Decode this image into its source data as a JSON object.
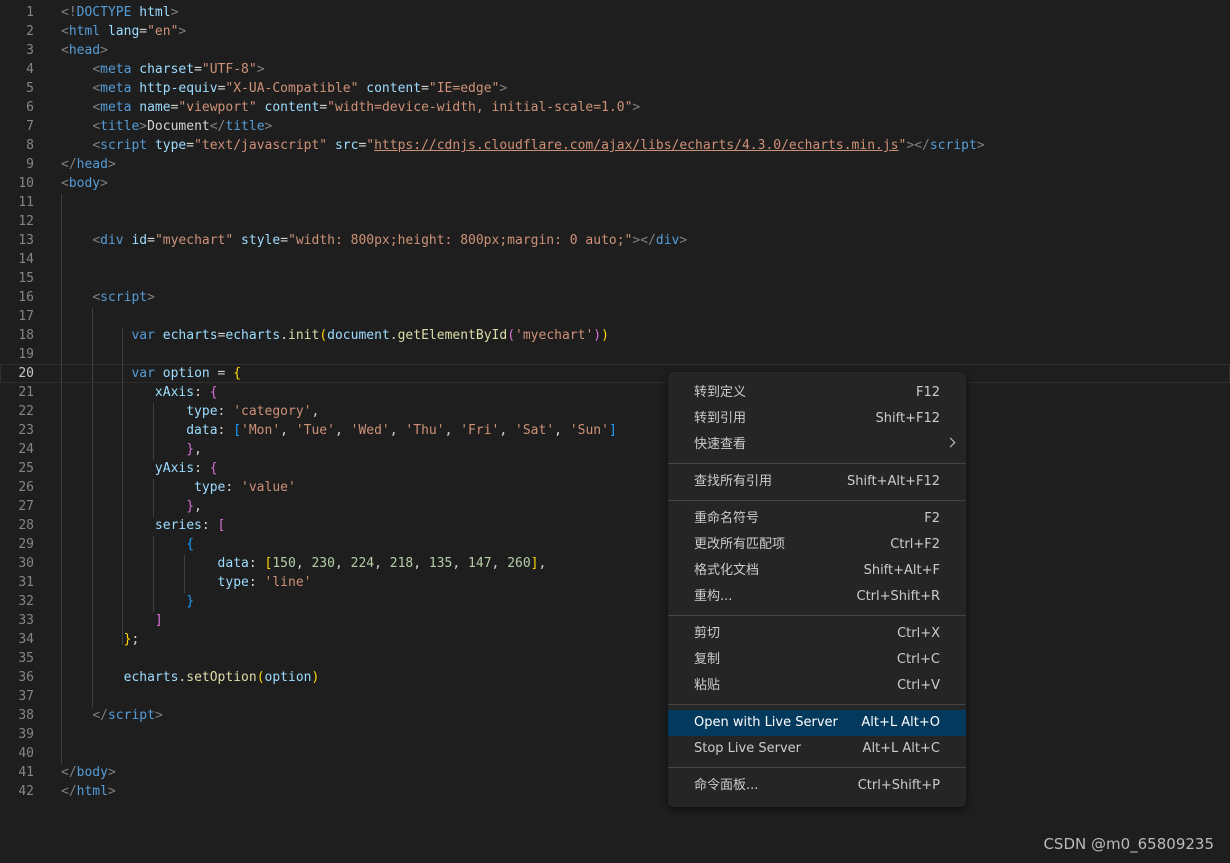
{
  "editor": {
    "current_line": "20",
    "line_numbers": [
      "1",
      "2",
      "3",
      "4",
      "5",
      "6",
      "7",
      "8",
      "9",
      "10",
      "11",
      "12",
      "13",
      "14",
      "15",
      "16",
      "17",
      "18",
      "19",
      "20",
      "21",
      "22",
      "23",
      "24",
      "25",
      "26",
      "27",
      "28",
      "29",
      "30",
      "31",
      "32",
      "33",
      "34",
      "35",
      "36",
      "37",
      "38",
      "39",
      "40",
      "41",
      "42"
    ],
    "lines": [
      [
        [
          "br",
          "<!"
        ],
        [
          "tag",
          "DOCTYPE"
        ],
        [
          "tx",
          " "
        ],
        [
          "at",
          "html"
        ],
        [
          "br",
          ">"
        ]
      ],
      [
        [
          "br",
          "<"
        ],
        [
          "tag",
          "html"
        ],
        [
          "tx",
          " "
        ],
        [
          "at",
          "lang"
        ],
        [
          "tx",
          "="
        ],
        [
          "st",
          "\"en\""
        ],
        [
          "br",
          ">"
        ]
      ],
      [
        [
          "br",
          "<"
        ],
        [
          "tag",
          "head"
        ],
        [
          "br",
          ">"
        ]
      ],
      [
        [
          "tx",
          "    "
        ],
        [
          "br",
          "<"
        ],
        [
          "tag",
          "meta"
        ],
        [
          "tx",
          " "
        ],
        [
          "at",
          "charset"
        ],
        [
          "tx",
          "="
        ],
        [
          "st",
          "\"UTF-8\""
        ],
        [
          "br",
          ">"
        ]
      ],
      [
        [
          "tx",
          "    "
        ],
        [
          "br",
          "<"
        ],
        [
          "tag",
          "meta"
        ],
        [
          "tx",
          " "
        ],
        [
          "at",
          "http-equiv"
        ],
        [
          "tx",
          "="
        ],
        [
          "st",
          "\"X-UA-Compatible\""
        ],
        [
          "tx",
          " "
        ],
        [
          "at",
          "content"
        ],
        [
          "tx",
          "="
        ],
        [
          "st",
          "\"IE=edge\""
        ],
        [
          "br",
          ">"
        ]
      ],
      [
        [
          "tx",
          "    "
        ],
        [
          "br",
          "<"
        ],
        [
          "tag",
          "meta"
        ],
        [
          "tx",
          " "
        ],
        [
          "at",
          "name"
        ],
        [
          "tx",
          "="
        ],
        [
          "st",
          "\"viewport\""
        ],
        [
          "tx",
          " "
        ],
        [
          "at",
          "content"
        ],
        [
          "tx",
          "="
        ],
        [
          "st",
          "\"width=device-width, initial-scale=1.0\""
        ],
        [
          "br",
          ">"
        ]
      ],
      [
        [
          "tx",
          "    "
        ],
        [
          "br",
          "<"
        ],
        [
          "tag",
          "title"
        ],
        [
          "br",
          ">"
        ],
        [
          "tx",
          "Document"
        ],
        [
          "br",
          "</"
        ],
        [
          "tag",
          "title"
        ],
        [
          "br",
          ">"
        ]
      ],
      [
        [
          "tx",
          "    "
        ],
        [
          "br",
          "<"
        ],
        [
          "tag",
          "script"
        ],
        [
          "tx",
          " "
        ],
        [
          "at",
          "type"
        ],
        [
          "tx",
          "="
        ],
        [
          "st",
          "\"text/javascript\""
        ],
        [
          "tx",
          " "
        ],
        [
          "at",
          "src"
        ],
        [
          "tx",
          "="
        ],
        [
          "st",
          "\""
        ],
        [
          "lk",
          "https://cdnjs.cloudflare.com/ajax/libs/echarts/4.3.0/echarts.min.js"
        ],
        [
          "st",
          "\""
        ],
        [
          "br",
          "></"
        ],
        [
          "tag",
          "script"
        ],
        [
          "br",
          ">"
        ]
      ],
      [
        [
          "br",
          "</"
        ],
        [
          "tag",
          "head"
        ],
        [
          "br",
          ">"
        ]
      ],
      [
        [
          "br",
          "<"
        ],
        [
          "tag",
          "body"
        ],
        [
          "br",
          ">"
        ]
      ],
      [],
      [],
      [
        [
          "tx",
          "    "
        ],
        [
          "br",
          "<"
        ],
        [
          "tag",
          "div"
        ],
        [
          "tx",
          " "
        ],
        [
          "at",
          "id"
        ],
        [
          "tx",
          "="
        ],
        [
          "st",
          "\"myechart\""
        ],
        [
          "tx",
          " "
        ],
        [
          "at",
          "style"
        ],
        [
          "tx",
          "="
        ],
        [
          "st",
          "\"width: 800px;height: 800px;margin: 0 auto;\""
        ],
        [
          "br",
          "></"
        ],
        [
          "tag",
          "div"
        ],
        [
          "br",
          ">"
        ]
      ],
      [],
      [],
      [
        [
          "tx",
          "    "
        ],
        [
          "br",
          "<"
        ],
        [
          "tag",
          "script"
        ],
        [
          "br",
          ">"
        ]
      ],
      [],
      [
        [
          "tx",
          "         "
        ],
        [
          "kw",
          "var"
        ],
        [
          "tx",
          " "
        ],
        [
          "vr",
          "echarts"
        ],
        [
          "tx",
          "="
        ],
        [
          "vr",
          "echarts"
        ],
        [
          "tx",
          "."
        ],
        [
          "fn",
          "init"
        ],
        [
          "p1",
          "("
        ],
        [
          "vr",
          "document"
        ],
        [
          "tx",
          "."
        ],
        [
          "fn",
          "getElementById"
        ],
        [
          "p2",
          "("
        ],
        [
          "st",
          "'myechart'"
        ],
        [
          "p2",
          ")"
        ],
        [
          "p1",
          ")"
        ]
      ],
      [],
      [
        [
          "tx",
          "         "
        ],
        [
          "kw",
          "var"
        ],
        [
          "tx",
          " "
        ],
        [
          "vr",
          "option"
        ],
        [
          "tx",
          " = "
        ],
        [
          "p1",
          "{"
        ]
      ],
      [
        [
          "tx",
          "            "
        ],
        [
          "vr",
          "xAxis"
        ],
        [
          "tx",
          ": "
        ],
        [
          "p2",
          "{"
        ]
      ],
      [
        [
          "tx",
          "                "
        ],
        [
          "vr",
          "type"
        ],
        [
          "tx",
          ": "
        ],
        [
          "st",
          "'category'"
        ],
        [
          "tx",
          ","
        ]
      ],
      [
        [
          "tx",
          "                "
        ],
        [
          "vr",
          "data"
        ],
        [
          "tx",
          ": "
        ],
        [
          "p3",
          "["
        ],
        [
          "st",
          "'Mon'"
        ],
        [
          "tx",
          ", "
        ],
        [
          "st",
          "'Tue'"
        ],
        [
          "tx",
          ", "
        ],
        [
          "st",
          "'Wed'"
        ],
        [
          "tx",
          ", "
        ],
        [
          "st",
          "'Thu'"
        ],
        [
          "tx",
          ", "
        ],
        [
          "st",
          "'Fri'"
        ],
        [
          "tx",
          ", "
        ],
        [
          "st",
          "'Sat'"
        ],
        [
          "tx",
          ", "
        ],
        [
          "st",
          "'Sun'"
        ],
        [
          "p3",
          "]"
        ]
      ],
      [
        [
          "tx",
          "                "
        ],
        [
          "p2",
          "}"
        ],
        [
          "tx",
          ","
        ]
      ],
      [
        [
          "tx",
          "            "
        ],
        [
          "vr",
          "yAxis"
        ],
        [
          "tx",
          ": "
        ],
        [
          "p2",
          "{"
        ]
      ],
      [
        [
          "tx",
          "                 "
        ],
        [
          "vr",
          "type"
        ],
        [
          "tx",
          ": "
        ],
        [
          "st",
          "'value'"
        ]
      ],
      [
        [
          "tx",
          "                "
        ],
        [
          "p2",
          "}"
        ],
        [
          "tx",
          ","
        ]
      ],
      [
        [
          "tx",
          "            "
        ],
        [
          "vr",
          "series"
        ],
        [
          "tx",
          ": "
        ],
        [
          "p2",
          "["
        ]
      ],
      [
        [
          "tx",
          "                "
        ],
        [
          "p3",
          "{"
        ]
      ],
      [
        [
          "tx",
          "                    "
        ],
        [
          "vr",
          "data"
        ],
        [
          "tx",
          ": "
        ],
        [
          "p1",
          "["
        ],
        [
          "nm",
          "150"
        ],
        [
          "tx",
          ", "
        ],
        [
          "nm",
          "230"
        ],
        [
          "tx",
          ", "
        ],
        [
          "nm",
          "224"
        ],
        [
          "tx",
          ", "
        ],
        [
          "nm",
          "218"
        ],
        [
          "tx",
          ", "
        ],
        [
          "nm",
          "135"
        ],
        [
          "tx",
          ", "
        ],
        [
          "nm",
          "147"
        ],
        [
          "tx",
          ", "
        ],
        [
          "nm",
          "260"
        ],
        [
          "p1",
          "]"
        ],
        [
          "tx",
          ","
        ]
      ],
      [
        [
          "tx",
          "                    "
        ],
        [
          "vr",
          "type"
        ],
        [
          "tx",
          ": "
        ],
        [
          "st",
          "'line'"
        ]
      ],
      [
        [
          "tx",
          "                "
        ],
        [
          "p3",
          "}"
        ]
      ],
      [
        [
          "tx",
          "            "
        ],
        [
          "p2",
          "]"
        ]
      ],
      [
        [
          "tx",
          "        "
        ],
        [
          "p1",
          "}"
        ],
        [
          "tx",
          ";"
        ]
      ],
      [],
      [
        [
          "tx",
          "        "
        ],
        [
          "vr",
          "echarts"
        ],
        [
          "tx",
          "."
        ],
        [
          "fn",
          "setOption"
        ],
        [
          "p1",
          "("
        ],
        [
          "vr",
          "option"
        ],
        [
          "p1",
          ")"
        ]
      ],
      [],
      [
        [
          "tx",
          "    "
        ],
        [
          "br",
          "</"
        ],
        [
          "tag",
          "script"
        ],
        [
          "br",
          ">"
        ]
      ],
      [],
      [],
      [
        [
          "br",
          "</"
        ],
        [
          "tag",
          "body"
        ],
        [
          "br",
          ">"
        ]
      ],
      [
        [
          "br",
          "</"
        ],
        [
          "tag",
          "html"
        ],
        [
          "br",
          ">"
        ]
      ]
    ]
  },
  "context_menu": {
    "groups": [
      [
        {
          "label": "转到定义",
          "shortcut": "F12"
        },
        {
          "label": "转到引用",
          "shortcut": "Shift+F12"
        },
        {
          "label": "快速查看",
          "shortcut": "",
          "submenu": true,
          "icon": "chevron-right-icon"
        }
      ],
      [
        {
          "label": "查找所有引用",
          "shortcut": "Shift+Alt+F12"
        }
      ],
      [
        {
          "label": "重命名符号",
          "shortcut": "F2"
        },
        {
          "label": "更改所有匹配项",
          "shortcut": "Ctrl+F2"
        },
        {
          "label": "格式化文档",
          "shortcut": "Shift+Alt+F"
        },
        {
          "label": "重构...",
          "shortcut": "Ctrl+Shift+R"
        }
      ],
      [
        {
          "label": "剪切",
          "shortcut": "Ctrl+X"
        },
        {
          "label": "复制",
          "shortcut": "Ctrl+C"
        },
        {
          "label": "粘贴",
          "shortcut": "Ctrl+V"
        }
      ],
      [
        {
          "label": "Open with Live Server",
          "shortcut": "Alt+L Alt+O",
          "highlighted": true
        },
        {
          "label": "Stop Live Server",
          "shortcut": "Alt+L Alt+C"
        }
      ],
      [
        {
          "label": "命令面板...",
          "shortcut": "Ctrl+Shift+P"
        }
      ]
    ]
  },
  "watermark": "CSDN @m0_65809235",
  "colors": {
    "background": "#1e1e1e",
    "menu_background": "#252526",
    "menu_highlight": "#04395e",
    "line_number": "#858585"
  }
}
